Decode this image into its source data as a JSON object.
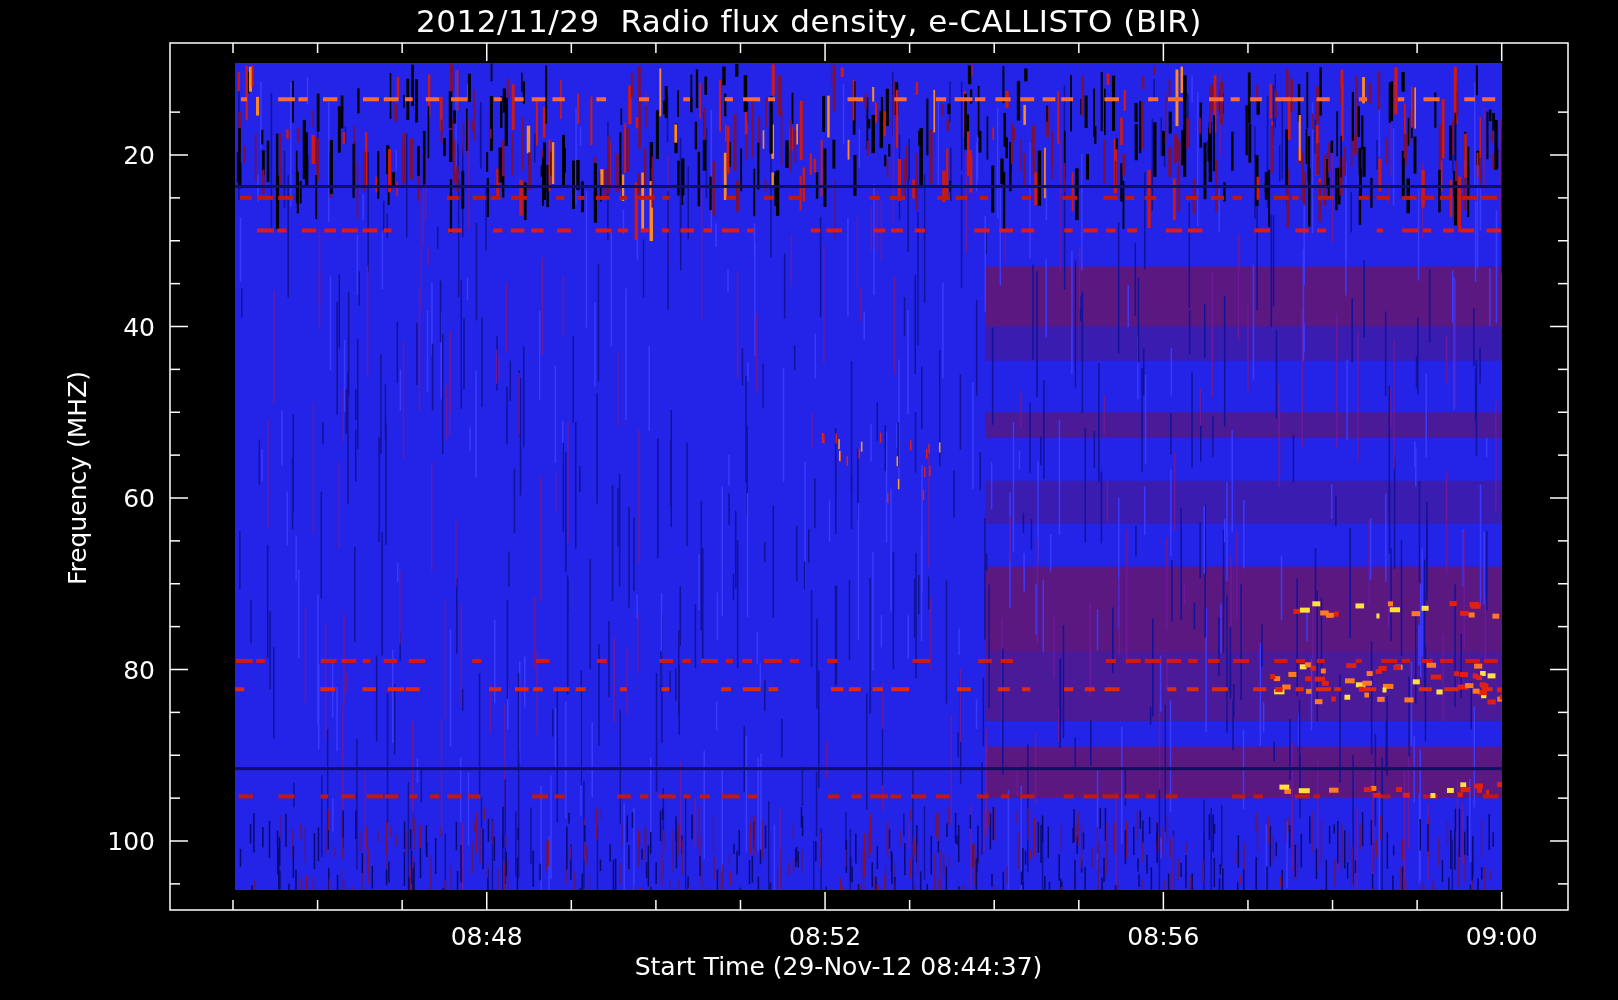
{
  "title": "2012/11/29  Radio flux density, e-CALLISTO (BIR)",
  "y_axis": {
    "label": "Frequency (MHZ)",
    "ticks": [
      "20",
      "40",
      "60",
      "80",
      "100"
    ]
  },
  "x_axis": {
    "label": "Start Time (29-Nov-12 08:44:37)",
    "ticks": [
      "08:48",
      "08:52",
      "08:56",
      "09:00"
    ]
  }
}
